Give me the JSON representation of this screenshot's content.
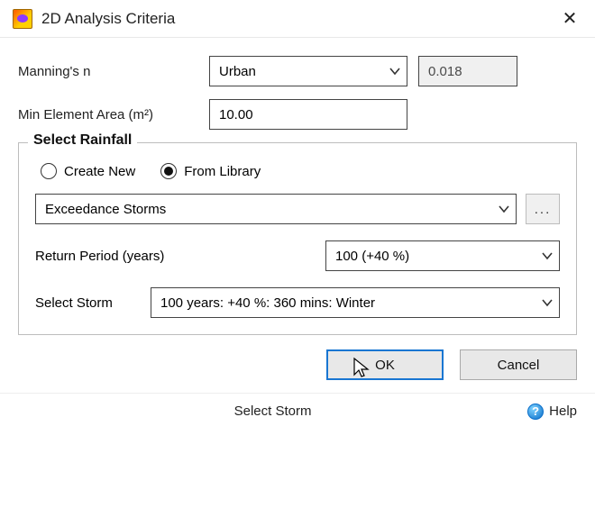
{
  "title": "2D Analysis Criteria",
  "labels": {
    "mannings_n": "Manning's n",
    "min_element_area": "Min Element Area (m²)"
  },
  "mannings_n": {
    "selected": "Urban",
    "value": "0.018"
  },
  "min_element_area_value": "10.00",
  "rainfall": {
    "legend": "Select Rainfall",
    "radios": {
      "create_new": "Create New",
      "from_library": "From Library",
      "selected": "from_library"
    },
    "library": {
      "selected": "Exceedance Storms",
      "browse": "..."
    },
    "return_period": {
      "label": "Return Period (years)",
      "selected": "100 (+40 %)"
    },
    "select_storm": {
      "label": "Select Storm",
      "selected": "100 years: +40 %: 360 mins: Winter"
    }
  },
  "buttons": {
    "ok": "OK",
    "cancel": "Cancel"
  },
  "statusbar": {
    "text": "Select Storm",
    "help": "Help"
  }
}
